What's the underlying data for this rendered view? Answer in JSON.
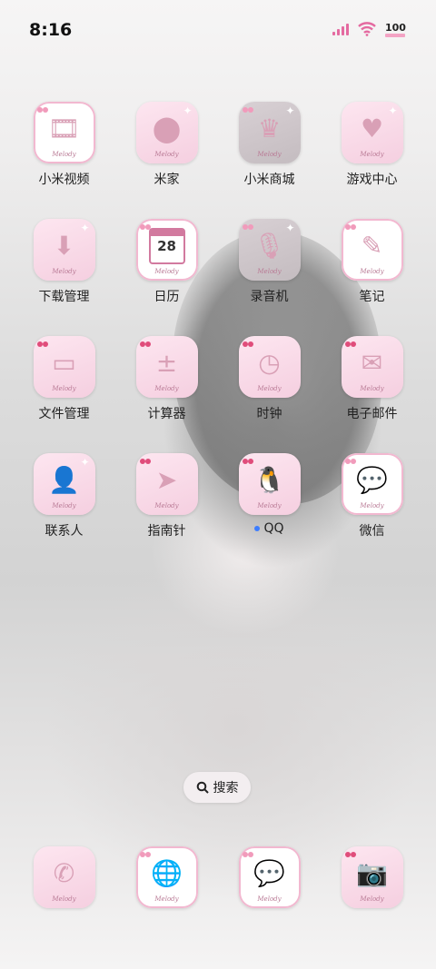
{
  "status_bar": {
    "time": "8:16",
    "battery": "100",
    "icons": [
      "signal-icon",
      "wifi-icon",
      "battery-icon"
    ]
  },
  "brand_text": "Melody",
  "apps": [
    {
      "label": "小米视频",
      "icon": "film-reel-icon",
      "glyph": "🎞",
      "style": "framed",
      "badge": "flower"
    },
    {
      "label": "米家",
      "icon": "mijia-icon",
      "glyph": "⬤",
      "style": "tile",
      "badge": "sparkle"
    },
    {
      "label": "小米商城",
      "icon": "crown-icon",
      "glyph": "♛",
      "style": "dim",
      "badge": "flower"
    },
    {
      "label": "游戏中心",
      "icon": "heart-drip-icon",
      "glyph": "♥",
      "style": "tile",
      "badge": "sparkle"
    },
    {
      "label": "下载管理",
      "icon": "download-gear-icon",
      "glyph": "⬇",
      "style": "tile",
      "badge": "sparkle"
    },
    {
      "label": "日历",
      "icon": "calendar-icon",
      "glyph": "28",
      "style": "framed",
      "badge": "flower"
    },
    {
      "label": "录音机",
      "icon": "microphone-icon",
      "glyph": "🎙",
      "style": "dim",
      "badge": "flower"
    },
    {
      "label": "笔记",
      "icon": "notes-icon",
      "glyph": "✎",
      "style": "framed",
      "badge": "flower"
    },
    {
      "label": "文件管理",
      "icon": "folder-icon",
      "glyph": "▭",
      "style": "tile",
      "badge": "cherry"
    },
    {
      "label": "计算器",
      "icon": "calculator-icon",
      "glyph": "±",
      "style": "tile",
      "badge": "cherry"
    },
    {
      "label": "时钟",
      "icon": "clock-icon",
      "glyph": "◷",
      "style": "tile",
      "badge": "cherry"
    },
    {
      "label": "电子邮件",
      "icon": "mail-icon",
      "glyph": "✉",
      "style": "tile",
      "badge": "cherry"
    },
    {
      "label": "联系人",
      "icon": "contacts-icon",
      "glyph": "👤",
      "style": "tile",
      "badge": "sparkle"
    },
    {
      "label": "指南针",
      "icon": "compass-icon",
      "glyph": "➤",
      "style": "tile",
      "badge": "cherry"
    },
    {
      "label": "QQ",
      "icon": "qq-penguin-icon",
      "glyph": "🐧",
      "style": "tile",
      "badge": "cherry",
      "new_dot": true
    },
    {
      "label": "微信",
      "icon": "wechat-icon",
      "glyph": "💬",
      "style": "framed",
      "badge": "flower"
    }
  ],
  "search": {
    "label": "搜索",
    "icon": "search-icon"
  },
  "dock": [
    {
      "icon": "phone-icon",
      "glyph": "✆",
      "style": "tile",
      "badge": "none"
    },
    {
      "icon": "browser-icon",
      "glyph": "🌐",
      "style": "framed",
      "badge": "flower"
    },
    {
      "icon": "messages-icon",
      "glyph": "💬",
      "style": "framed",
      "badge": "flower"
    },
    {
      "icon": "camera-icon",
      "glyph": "📷",
      "style": "tile",
      "badge": "cherry"
    }
  ],
  "colors": {
    "accent_pink": "#f5cfe0",
    "signal_pink": "#e46aa0",
    "dot_blue": "#3d7dff"
  }
}
